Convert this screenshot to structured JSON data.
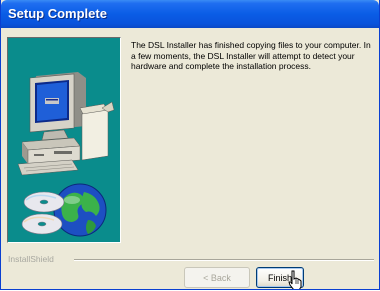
{
  "window": {
    "title": "Setup Complete"
  },
  "content": {
    "message": "The DSL Installer has finished copying files to your computer. In a few moments, the DSL Installer will attempt to detect your hardware and complete the installation process."
  },
  "footer": {
    "brand": "InstallShield"
  },
  "buttons": {
    "back_label": "< Back",
    "finish_label": "Finish"
  },
  "colors": {
    "title_bar": "#0a5de6",
    "dialog_bg": "#ece9d8",
    "art_panel_bg": "#0a8c8c"
  },
  "icons": [
    "computer-illustration",
    "globe-icon",
    "cd-disc-icon",
    "pointer-cursor"
  ]
}
